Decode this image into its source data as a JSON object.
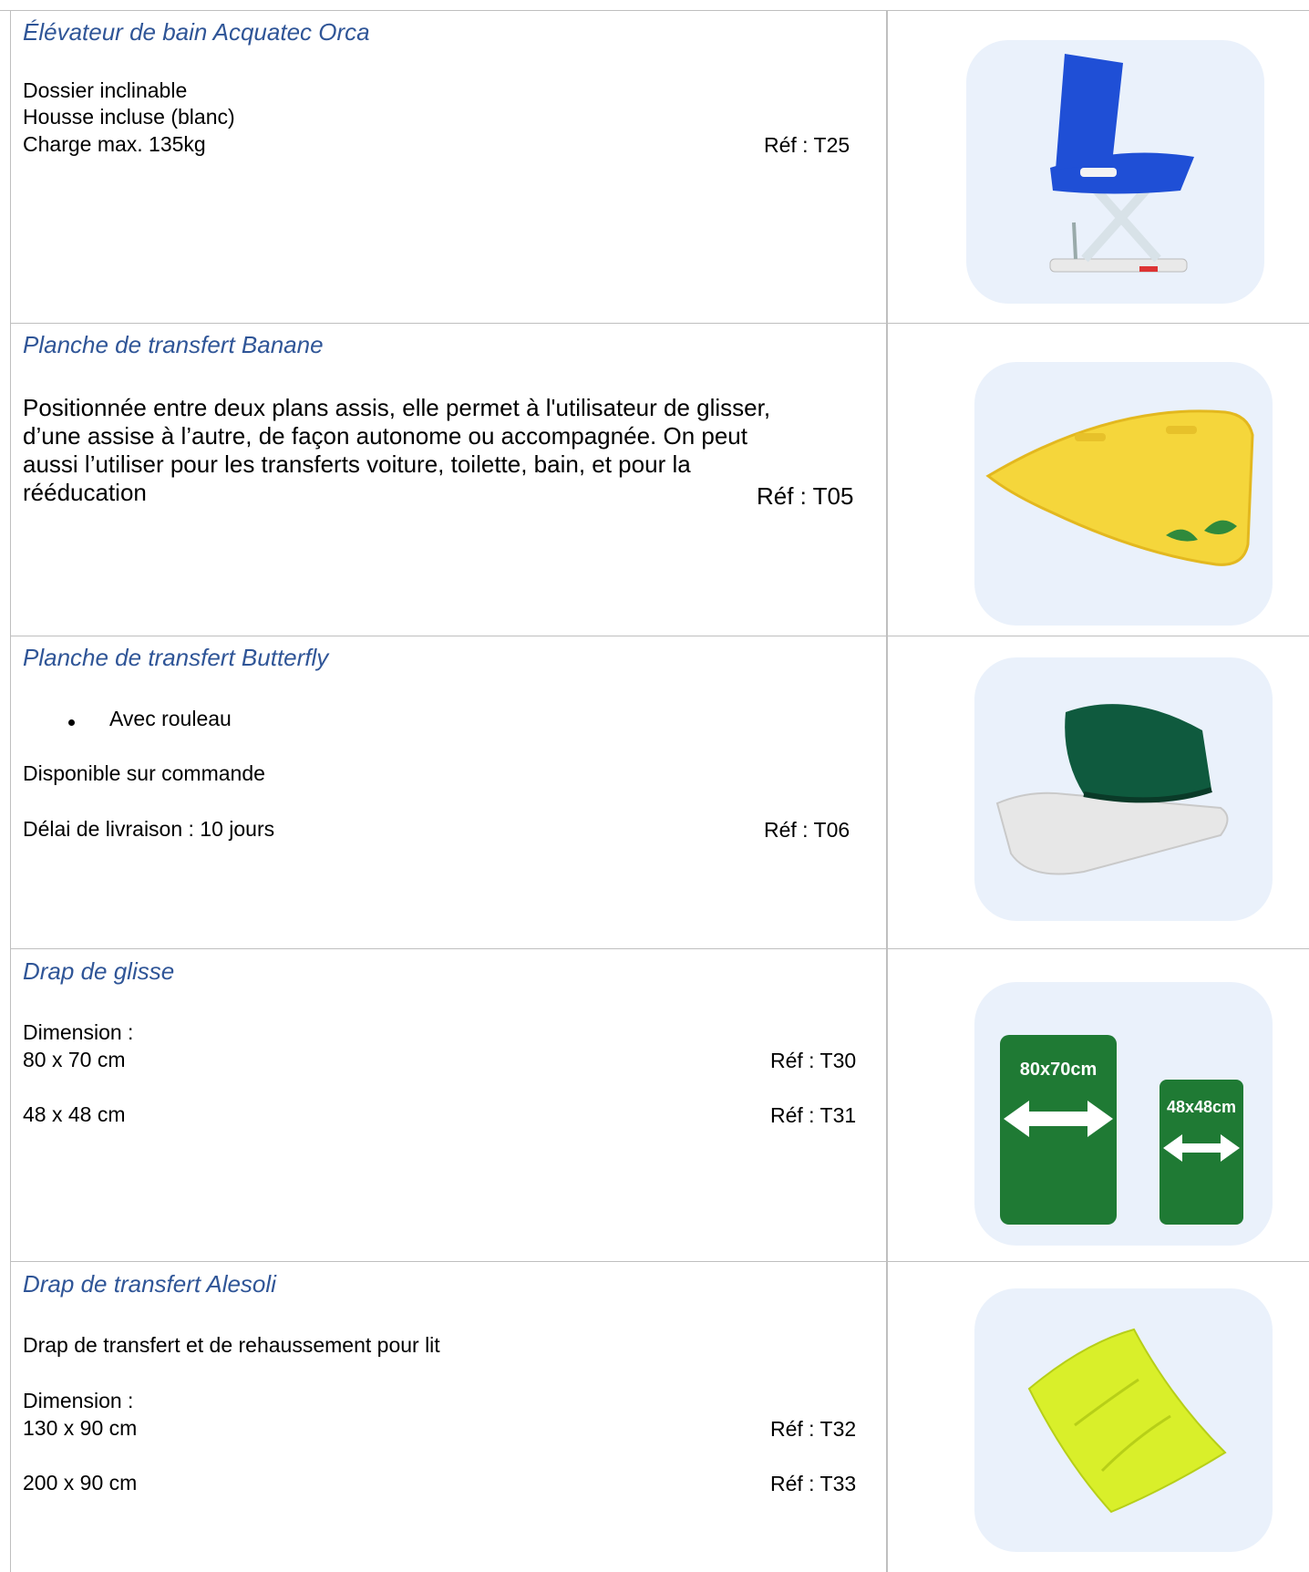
{
  "rows": [
    {
      "title": "Élévateur de bain Acquatec Orca",
      "lines": [
        "Dossier inclinable",
        "Housse incluse (blanc)",
        "Charge max. 135kg"
      ],
      "ref": "Réf :  T25",
      "image": {
        "icon": "bath-lift-chair-icon",
        "color": "#1f4fd6"
      }
    },
    {
      "title": "Planche de transfert Banane",
      "lines": [
        "Positionnée entre deux plans assis, elle permet à l'utilisateur de glisser,",
        "d’une assise à l’autre, de façon autonome ou accompagnée. On peut",
        "aussi l’utiliser pour les transferts voiture, toilette, bain, et pour la",
        "rééducation"
      ],
      "ref": "Réf : T05",
      "image": {
        "icon": "banana-transfer-board-icon",
        "color": "#f5d63b"
      }
    },
    {
      "title": "Planche de transfert Butterfly",
      "bullet": "Avec rouleau",
      "lines": [
        "Disponible sur commande",
        "Délai de livraison : 10 jours"
      ],
      "ref": "Réf : T06",
      "image": {
        "icon": "butterfly-transfer-board-icon",
        "color": "#0f5a3e"
      }
    },
    {
      "title": "Drap de glisse",
      "lines": [
        "Dimension :",
        "80 x 70 cm",
        "48 x 48 cm"
      ],
      "refs": [
        "Réf : T30",
        "Réf : T31"
      ],
      "image": {
        "icon": "slide-sheet-icon",
        "color": "#1f7a34",
        "labels": [
          "80x70cm",
          "48x48cm"
        ]
      }
    },
    {
      "title": "Drap de transfert Alesoli",
      "lines": [
        "Drap de transfert et de rehaussement pour lit",
        "Dimension :",
        "130 x 90 cm",
        "200 x 90 cm"
      ],
      "refs": [
        "Réf : T32",
        "Réf : T33"
      ],
      "image": {
        "icon": "transfer-sheet-icon",
        "color": "#d9ef2a"
      }
    }
  ]
}
